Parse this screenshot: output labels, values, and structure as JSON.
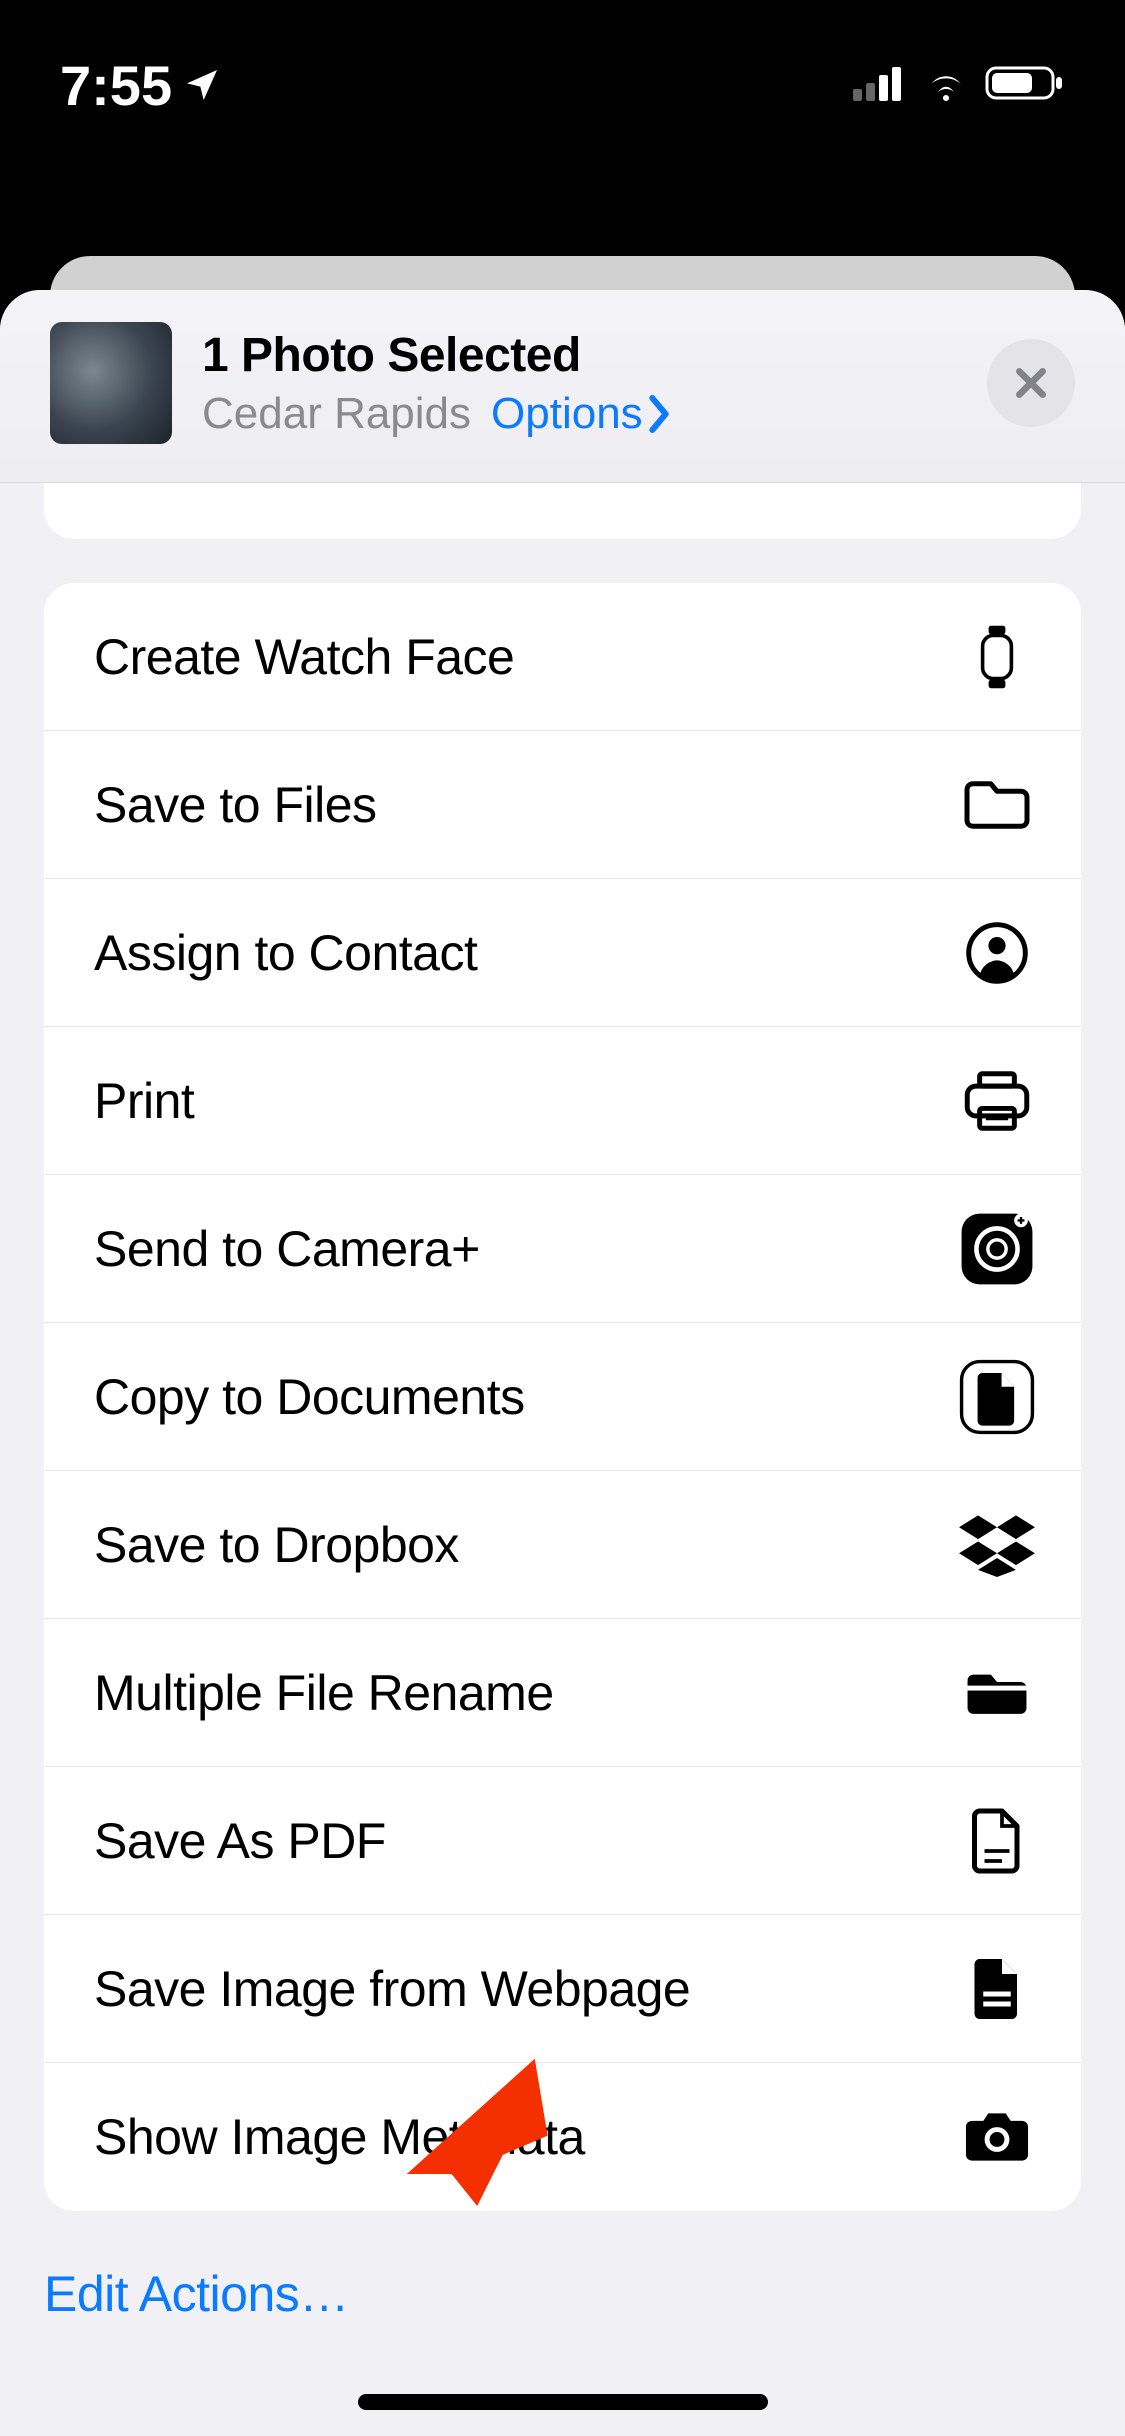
{
  "status": {
    "time": "7:55"
  },
  "header": {
    "title": "1 Photo Selected",
    "location": "Cedar Rapids",
    "options_label": "Options"
  },
  "actions": [
    {
      "label": "Create Watch Face",
      "icon": "watch-icon"
    },
    {
      "label": "Save to Files",
      "icon": "folder-outline-icon"
    },
    {
      "label": "Assign to Contact",
      "icon": "contact-circle-icon"
    },
    {
      "label": "Print",
      "icon": "printer-icon"
    },
    {
      "label": "Send to Camera+",
      "icon": "camera-plus-app-icon"
    },
    {
      "label": "Copy to Documents",
      "icon": "documents-app-icon"
    },
    {
      "label": "Save to Dropbox",
      "icon": "dropbox-icon"
    },
    {
      "label": "Multiple File Rename",
      "icon": "folder-filled-icon"
    },
    {
      "label": "Save As PDF",
      "icon": "doc-outline-icon"
    },
    {
      "label": "Save Image from Webpage",
      "icon": "doc-filled-icon"
    },
    {
      "label": "Show Image Metadata",
      "icon": "camera-filled-icon"
    }
  ],
  "footer": {
    "edit_actions_label": "Edit Actions…"
  }
}
